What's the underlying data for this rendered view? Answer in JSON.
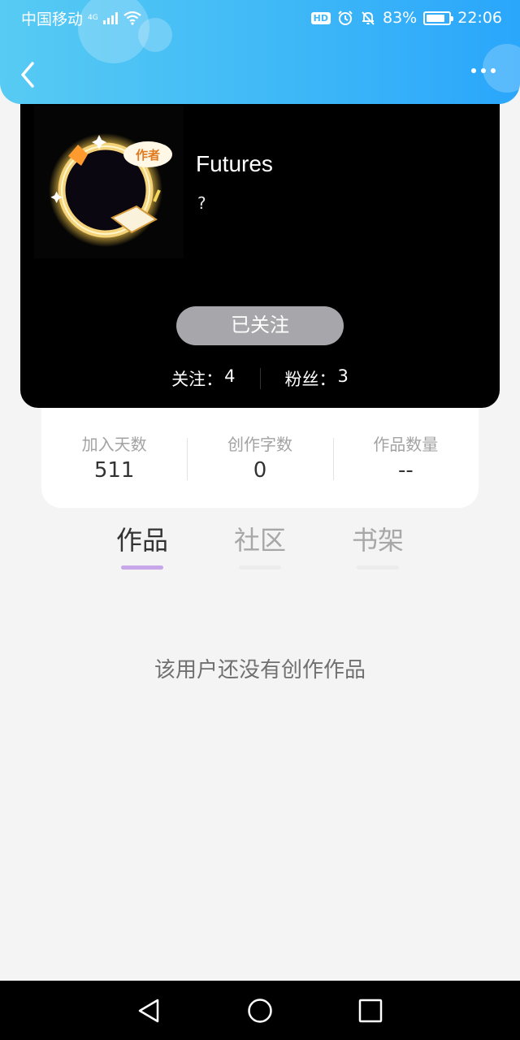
{
  "status_bar": {
    "carrier": "中国移动",
    "network": "4G",
    "hd_badge": "HD",
    "battery_percent": "83%",
    "battery_level": 0.83,
    "time": "22:06"
  },
  "header": {
    "back_icon": "chevron-left-icon",
    "more_icon": "more-dots-icon"
  },
  "profile": {
    "avatar_badge": "作者",
    "name": "Futures",
    "bio": "?",
    "follow_button": "已关注",
    "following_label": "关注：",
    "following_count": "4",
    "fans_label": "粉丝：",
    "fans_count": "3"
  },
  "stats": [
    {
      "label": "加入天数",
      "value": "511"
    },
    {
      "label": "创作字数",
      "value": "0"
    },
    {
      "label": "作品数量",
      "value": "--"
    }
  ],
  "tabs": [
    {
      "label": "作品",
      "active": true
    },
    {
      "label": "社区",
      "active": false
    },
    {
      "label": "书架",
      "active": false
    }
  ],
  "empty_message": "该用户还没有创作作品",
  "colors": {
    "header_gradient_start": "#57cbf3",
    "header_gradient_end": "#2aa6fb",
    "follow_button_bg": "#a7a6ab",
    "active_tab_underline": "#c7a6e9"
  }
}
